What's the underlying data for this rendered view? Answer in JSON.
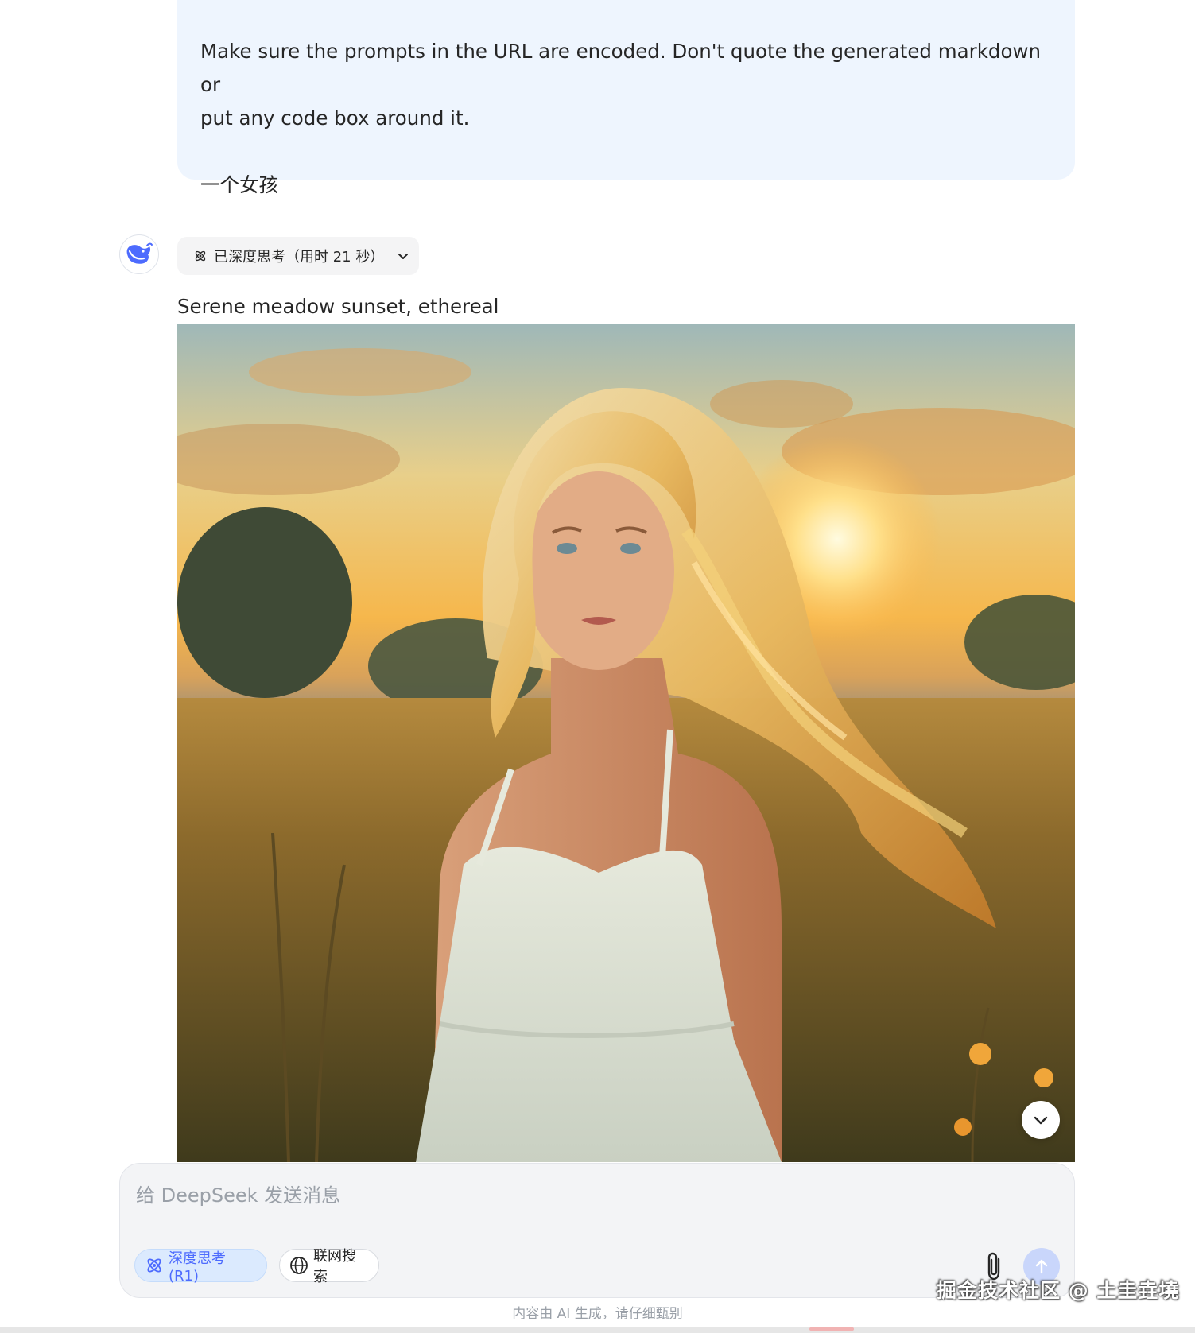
{
  "user_message": {
    "line1": "Make sure the prompts in the URL are encoded. Don't quote the generated markdown or",
    "line2": "put any code box around it.",
    "line3": "一个女孩"
  },
  "assistant": {
    "avatar_icon": "deepseek-whale-icon",
    "thinking_label": "已深度思考（用时 21 秒）",
    "thinking_icon": "atom-icon",
    "expand_icon": "chevron-down-icon",
    "answer_text": "Serene meadow sunset, ethereal",
    "image_subject": "generated-image"
  },
  "composer": {
    "placeholder": "给 DeepSeek 发送消息",
    "deep_think_label": "深度思考 (R1)",
    "web_search_label": "联网搜索",
    "attach_icon": "paperclip-icon",
    "send_icon": "arrow-up-icon"
  },
  "footer": {
    "disclaimer": "内容由 AI 生成，请仔细甄别",
    "watermark": "掘金技术社区 @ 土圭垚墝"
  },
  "colors": {
    "accent": "#4d6bfe",
    "bubble_bg": "#eef5fe",
    "chip_bg": "#f4f4f5"
  }
}
